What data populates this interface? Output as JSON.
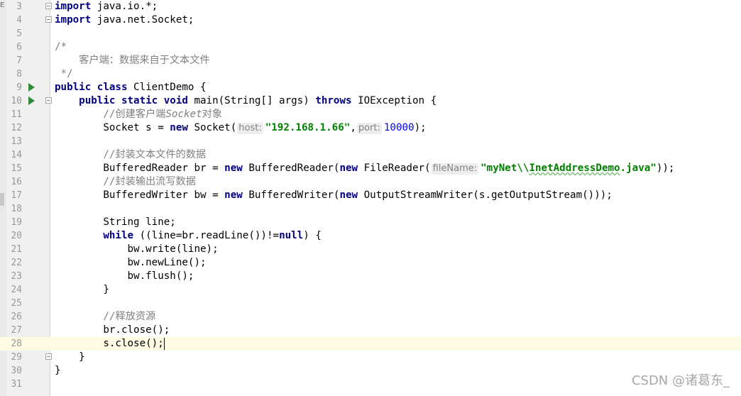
{
  "gutter": {
    "strip_marker": "E"
  },
  "lines": [
    {
      "number": "3",
      "run": false,
      "fold": true,
      "current": false
    },
    {
      "number": "4",
      "run": false,
      "fold": true,
      "current": false
    },
    {
      "number": "5",
      "run": false,
      "fold": false,
      "current": false
    },
    {
      "number": "6",
      "run": false,
      "fold": false,
      "current": false
    },
    {
      "number": "7",
      "run": false,
      "fold": false,
      "current": false
    },
    {
      "number": "8",
      "run": false,
      "fold": false,
      "current": false
    },
    {
      "number": "9",
      "run": true,
      "fold": false,
      "current": false
    },
    {
      "number": "10",
      "run": true,
      "fold": true,
      "current": false
    },
    {
      "number": "11",
      "run": false,
      "fold": false,
      "current": false
    },
    {
      "number": "12",
      "run": false,
      "fold": false,
      "current": false
    },
    {
      "number": "13",
      "run": false,
      "fold": false,
      "current": false
    },
    {
      "number": "14",
      "run": false,
      "fold": false,
      "current": false
    },
    {
      "number": "15",
      "run": false,
      "fold": false,
      "current": false
    },
    {
      "number": "16",
      "run": false,
      "fold": false,
      "current": false
    },
    {
      "number": "17",
      "run": false,
      "fold": false,
      "current": false
    },
    {
      "number": "18",
      "run": false,
      "fold": false,
      "current": false
    },
    {
      "number": "19",
      "run": false,
      "fold": false,
      "current": false
    },
    {
      "number": "20",
      "run": false,
      "fold": false,
      "current": false
    },
    {
      "number": "21",
      "run": false,
      "fold": false,
      "current": false
    },
    {
      "number": "22",
      "run": false,
      "fold": false,
      "current": false
    },
    {
      "number": "23",
      "run": false,
      "fold": false,
      "current": false
    },
    {
      "number": "24",
      "run": false,
      "fold": false,
      "current": false
    },
    {
      "number": "25",
      "run": false,
      "fold": false,
      "current": false
    },
    {
      "number": "26",
      "run": false,
      "fold": false,
      "current": false
    },
    {
      "number": "27",
      "run": false,
      "fold": false,
      "current": false
    },
    {
      "number": "28",
      "run": false,
      "fold": false,
      "current": true
    },
    {
      "number": "29",
      "run": false,
      "fold": true,
      "current": false
    },
    {
      "number": "30",
      "run": false,
      "fold": false,
      "current": false
    },
    {
      "number": "31",
      "run": false,
      "fold": false,
      "current": false
    }
  ],
  "code": {
    "l3": {
      "kw": "import",
      "rest": " java.io.*;"
    },
    "l4": {
      "kw": "import",
      "rest": " java.net.Socket;"
    },
    "l6": {
      "text": "/*"
    },
    "l7": {
      "text": "    客户端：数据来自于文本文件"
    },
    "l8": {
      "text": " */"
    },
    "l9": {
      "kw1": "public",
      "kw2": "class",
      "rest": " ClientDemo {"
    },
    "l10": {
      "indent": "    ",
      "kw1": "public",
      "kw2": "static",
      "kw3": "void",
      "mid": " main(String[] args) ",
      "kw4": "throws",
      "rest": " IOException {"
    },
    "l11": {
      "indent": "        ",
      "pre": "//创建客户端",
      "it": "Socket",
      "post": "对象"
    },
    "l12": {
      "pre": "        Socket s = ",
      "kw": "new",
      "mid": " Socket(",
      "hint1": "host:",
      "str": "\"192.168.1.66\"",
      "sep": ",",
      "hint2": "port:",
      "num": "10000",
      "rest": ");"
    },
    "l14": {
      "text": "        //封装文本文件的数据"
    },
    "l15": {
      "pre": "        BufferedReader br = ",
      "kw1": "new",
      "mid1": " BufferedReader(",
      "kw2": "new",
      "mid2": " FileReader(",
      "hint": "fileName:",
      "str1": "\"myNet\\\\",
      "str2": "InetAddressDemo",
      "str3": ".java\"",
      "rest": "));"
    },
    "l16": {
      "text": "        //封装输出流写数据"
    },
    "l17": {
      "pre": "        BufferedWriter bw = ",
      "kw1": "new",
      "mid1": " BufferedWriter(",
      "kw2": "new",
      "rest": " OutputStreamWriter(s.getOutputStream()));"
    },
    "l19": {
      "text": "        String line;"
    },
    "l20": {
      "indent": "        ",
      "kw1": "while",
      "mid": " ((line=br.readLine())!=",
      "kw2": "null",
      "rest": ") {"
    },
    "l21": {
      "text": "            bw.write(line);"
    },
    "l22": {
      "text": "            bw.newLine();"
    },
    "l23": {
      "text": "            bw.flush();"
    },
    "l24": {
      "text": "        }"
    },
    "l26": {
      "text": "        //释放资源"
    },
    "l27": {
      "text": "        br.close();"
    },
    "l28": {
      "text": "        s.close();"
    },
    "l29": {
      "text": "    }"
    },
    "l30": {
      "text": "}"
    }
  },
  "watermark": "CSDN @诸葛东_"
}
